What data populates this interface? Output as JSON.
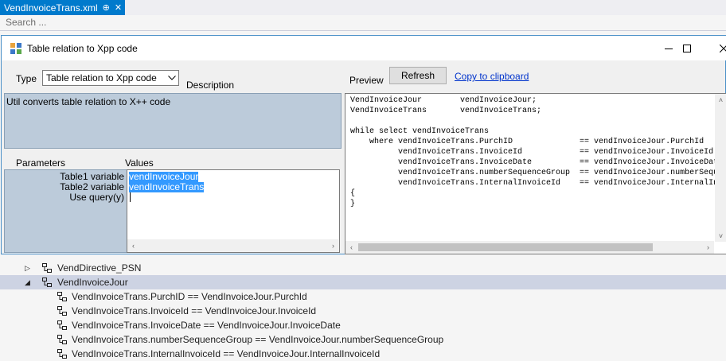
{
  "doc_tab": {
    "title": "VendInvoiceTrans.xml",
    "pin": "⊕",
    "close": "✕"
  },
  "search": {
    "placeholder": "Search ...",
    "value": ""
  },
  "dialog": {
    "title": "Table relation to Xpp code",
    "type_label": "Type",
    "type_value": "Table relation to Xpp code",
    "description_label": "Description",
    "description_text": "Util converts table relation to X++ code",
    "parameters_label": "Parameters",
    "values_label": "Values",
    "parameters": [
      {
        "name": "Table1 variable",
        "value": "vendInvoiceJour"
      },
      {
        "name": "Table2 variable",
        "value": "vendInvoiceTrans"
      },
      {
        "name": "Use query(y)",
        "value": ""
      }
    ],
    "preview_label": "Preview",
    "refresh_label": "Refresh",
    "copy_label": "Copy to clipboard",
    "preview_code": "VendInvoiceJour        vendInvoiceJour;\nVendInvoiceTrans       vendInvoiceTrans;\n\nwhile select vendInvoiceTrans\n    where vendInvoiceTrans.PurchID              == vendInvoiceJour.PurchId\n          vendInvoiceTrans.InvoiceId            == vendInvoiceJour.InvoiceId\n          vendInvoiceTrans.InvoiceDate          == vendInvoiceJour.InvoiceDate\n          vendInvoiceTrans.numberSequenceGroup  == vendInvoiceJour.numberSequenceGroup\n          vendInvoiceTrans.InternalInvoiceId    == vendInvoiceJour.InternalInvoiceId\n{\n}"
  },
  "tree": {
    "nodes": [
      {
        "label": "VendDirective_PSN",
        "expander": "▷",
        "selected": false
      },
      {
        "label": "VendInvoiceJour",
        "expander": "◢",
        "selected": true
      },
      {
        "label": "VendInvoiceTrans.PurchID == VendInvoiceJour.PurchId"
      },
      {
        "label": "VendInvoiceTrans.InvoiceId == VendInvoiceJour.InvoiceId"
      },
      {
        "label": "VendInvoiceTrans.InvoiceDate == VendInvoiceJour.InvoiceDate"
      },
      {
        "label": "VendInvoiceTrans.numberSequenceGroup == VendInvoiceJour.numberSequenceGroup"
      },
      {
        "label": "VendInvoiceTrans.InternalInvoiceId == VendInvoiceJour.InternalInvoiceId"
      }
    ]
  },
  "colors": {
    "accent": "#007acc",
    "selection": "#3399ff",
    "panel": "#bccbda",
    "tree_selection": "#cdd3e3"
  }
}
